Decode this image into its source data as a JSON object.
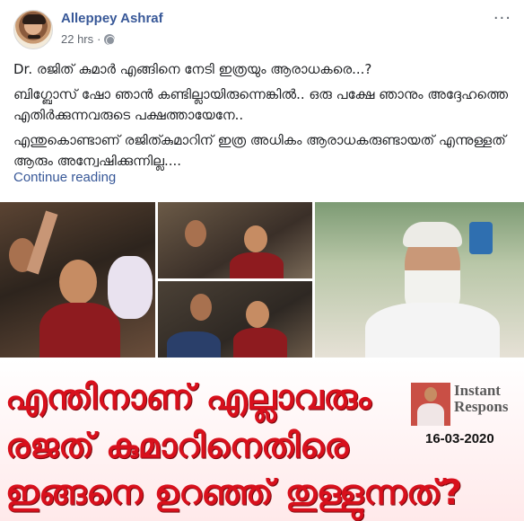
{
  "post": {
    "author": "Alleppey Ashraf",
    "time": "22 hrs",
    "separator": "·",
    "more_label": "···",
    "paragraphs": [
      "Dr. രജിത് കുമാർ എങ്ങിനെ നേടി ഇത്രയും ആരാധകരെ...?",
      "ബിഗ്ബോസ് ഷോ ഞാൻ കണ്ടില്ലായിരുന്നെങ്കിൽ.. ഒരു പക്ഷേ ഞാനും അദ്ദേഹത്തെ എതിർക്കുന്നവരുടെ പക്ഷത്തായേനേ..",
      "എന്തുകൊണ്ടാണ് രജിത്കുമാറിന് ഇത്ര അധികം ആരാധകരുണ്ടായത് എന്നുള്ളത് ആരും അന്വേഷിക്കുന്നില്ല...."
    ],
    "continue_label": "Continue reading"
  },
  "image": {
    "headline_lines": [
      "എന്തിനാണ് എല്ലാവരും",
      "രജത് കുമാറിനെതിരെ",
      "ഇങ്ങനെ ഉറഞ്ഞ് തുള്ളുന്നത്?"
    ],
    "instant_label_1": "Instant",
    "instant_label_2": "Respons",
    "date": "16-03-2020"
  },
  "colors": {
    "link": "#385898",
    "headline_red": "#d8101c"
  }
}
